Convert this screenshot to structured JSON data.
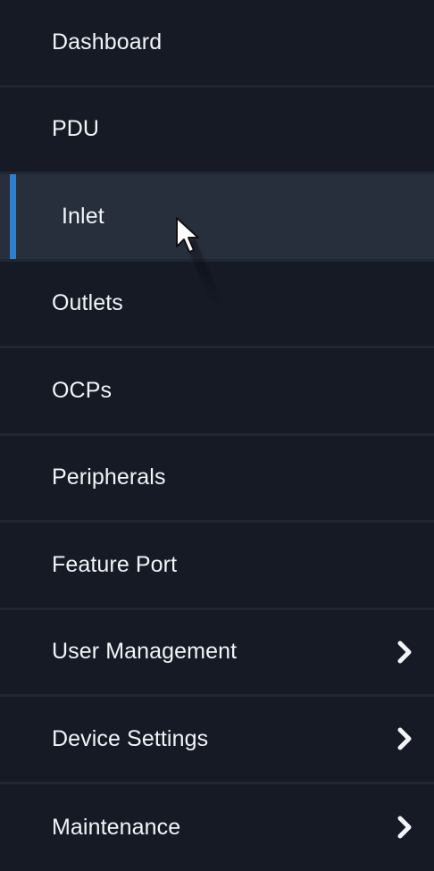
{
  "nav": {
    "items": [
      {
        "label": "Dashboard",
        "active": false,
        "has_submenu": false
      },
      {
        "label": "PDU",
        "active": false,
        "has_submenu": false
      },
      {
        "label": "Inlet",
        "active": true,
        "has_submenu": false
      },
      {
        "label": "Outlets",
        "active": false,
        "has_submenu": false
      },
      {
        "label": "OCPs",
        "active": false,
        "has_submenu": false
      },
      {
        "label": "Peripherals",
        "active": false,
        "has_submenu": false
      },
      {
        "label": "Feature Port",
        "active": false,
        "has_submenu": false
      },
      {
        "label": "User Management",
        "active": false,
        "has_submenu": true,
        "icon": "chevron-right-icon"
      },
      {
        "label": "Device Settings",
        "active": false,
        "has_submenu": true,
        "icon": "chevron-right-icon"
      },
      {
        "label": "Maintenance",
        "active": false,
        "has_submenu": true,
        "icon": "chevron-right-icon"
      }
    ]
  },
  "colors": {
    "background": "#151a24",
    "active_background": "#272f3d",
    "active_accent": "#2f7fd0",
    "divider": "#202633",
    "text": "#f2f4f7"
  },
  "cursor": {
    "icon": "mouse-pointer-icon"
  }
}
